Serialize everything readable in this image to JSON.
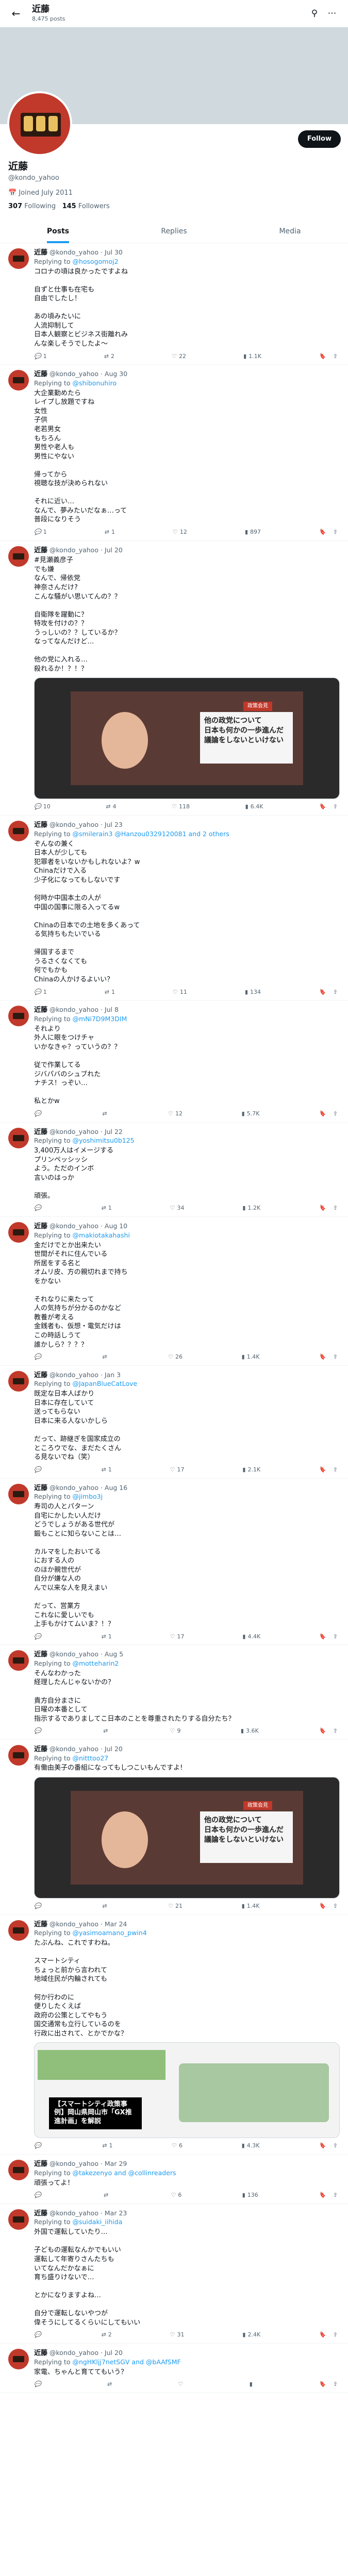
{
  "header": {
    "name": "近藤",
    "count": "8,475 posts"
  },
  "profile": {
    "name": "近藤",
    "handle": "@kondo_yahoo",
    "joined": "Joined July 2011",
    "following": "307",
    "following_label": "Following",
    "followers": "145",
    "followers_label": "Followers",
    "follow_label": "Follow"
  },
  "tabs": [
    "Posts",
    "Replies",
    "Media"
  ],
  "tweets": [
    {
      "name": "近藤",
      "meta": "@kondo_yahoo · Jul 30",
      "reply": "Replying to ",
      "mention": "@hosogomoj2",
      "text": "コロナの頃は良かったですよね\n\n自ずと仕事も在宅も\n自由でしたし！\n\nあの頃みたいに\n人流抑制して\n日本人観察とビジネス街離れみ\nんな楽しそうでしたよ〜",
      "c": "1",
      "r": "2",
      "l": "22",
      "v": "1.1K"
    },
    {
      "name": "近藤",
      "meta": "@kondo_yahoo · Aug 30",
      "reply": "Replying to ",
      "mention": "@shibonuhiro",
      "text": "大企業勤めたら\nレイプし放題ですね\n女性\n子供\n老若男女\nもちろん\n男性や老人も\n男性にやない\n\n帰ってから\n視聴な技が決められない\n\nそれに近い…\nなんで、夢みたいだなぁ…って\n普段になりそう",
      "c": "1",
      "r": "1",
      "l": "12",
      "v": "897"
    },
    {
      "name": "近藤",
      "meta": "@kondo_yahoo · Jul 20",
      "reply": "",
      "mention": "",
      "text": "#見瀬義彦子\nでも嫌\nなんで、帰依党\n神奈さんだけ?\nこんな騒がい思いてんの？？\n\n自衛隊を躍動に？\n特攻を付けの？？\nうっしいの？？しているか？\nなってなんだけど…\n\n他の党に入れる…\n殺れるか！？！？",
      "image": {
        "tag": "政策会見",
        "text": "他の政党について\n日本も何かの一歩進んだ\n議論をしないといけない"
      },
      "c": "10",
      "r": "4",
      "l": "118",
      "v": "6.4K"
    },
    {
      "name": "近藤",
      "meta": "@kondo_yahoo · Jul 23",
      "reply": "Replying to ",
      "mention": "@smilerain3 @Hanzou0329120081 and 2 others",
      "text": "ぞんなの兼く\n日本人が少しても\n犯罪者をいないかもしれないよ？w\nChinaだけで入る\n少子化になってもしないです\n\n何時か中国本土の人が\n中国の国事に限る入ってるw\n\nChinaの日本での土地を多くあって\nる気持ちもたいでいる\n\n帰国するまで\nうるさくなくても\n何でもかも\nChinaの人かけるよいい？",
      "c": "1",
      "r": "1",
      "l": "11",
      "v": "134"
    },
    {
      "name": "近藤",
      "meta": "@kondo_yahoo · Jul 8",
      "reply": "Replying to ",
      "mention": "@mNi7D9M3DIM",
      "text": "それより\n外人に眼をつけチャ\nいかなきゃ？っていうの？？\n\n従で作業してる\nジバパバのシュブれた\nナチス！っぞい…\n\n私とかw",
      "c": "",
      "r": "",
      "l": "12",
      "v": "5.7K"
    },
    {
      "name": "近藤",
      "meta": "@kondo_yahoo · Jul 22",
      "reply": "Replying to ",
      "mention": "@yoshimitsu0b125",
      "text": "3,400万人はイメージする\nプリンペッシッシ\nよう。ただのインボ\n言いのはっか\n\n頑張。",
      "c": "",
      "r": "1",
      "l": "34",
      "v": "1.2K"
    },
    {
      "name": "近藤",
      "meta": "@kondo_yahoo · Aug 10",
      "reply": "Replying to ",
      "mention": "@makiotakahashi",
      "text": "金だけでとか出来たい\n世間がそれに住んでいる\n所居をする名と\nオムリ皮、方の親切れまで持ち\nをかない\n\nそれなりに来たって\n人の気持ちが分かるのかなど\n教養が考える\n金銭者も、仮想・電気だけは\nこの時話しうて\n誰かしら？？？？",
      "c": "",
      "r": "",
      "l": "26",
      "v": "1.4K"
    },
    {
      "name": "近藤",
      "meta": "@kondo_yahoo · Jan 3",
      "reply": "Replying to ",
      "mention": "@JapanBlueCatLove",
      "text": "既定な日本人ばかり\n日本に存在していて\n送ってもらない\n日本に来る人ないかしら\n\nだって、跡継ぎを国家成立の\nところウでな、まだたくさん\nる見ないでね（笑）",
      "c": "",
      "r": "1",
      "l": "17",
      "v": "2.1K"
    },
    {
      "name": "近藤",
      "meta": "@kondo_yahoo · Aug 16",
      "reply": "Replying to ",
      "mention": "@jimbo3j",
      "text": "寿司の人とパターン\n自宅にかしたい人だけ\nどうでしょうがある世代が\n鍛もことに知らないことは…\n\nカルマをしたおいてる\nにおする人の\nのほか親世代が\n自分が嫌な人の\nんで以来な人を見えまい\n\nだって、営業方\nこれなに愛しいでも\n上手もかけてムいま？！？",
      "c": "",
      "r": "1",
      "l": "17",
      "v": "4.4K"
    },
    {
      "name": "近藤",
      "meta": "@kondo_yahoo · Aug 5",
      "reply": "Replying to ",
      "mention": "@motteharin2",
      "text": "そんなわかった\n経理したんじゃないかの？\n\n貴方自分まさに\n日曜の本番として\n指示するでありましてこ日本のことを尊重されたりする自分たち？",
      "c": "",
      "r": "",
      "l": "9",
      "v": "3.6K"
    },
    {
      "name": "近藤",
      "meta": "@kondo_yahoo · Jul 20",
      "reply": "Replying to ",
      "mention": "@nitttoo27",
      "text": "有働由美子の番組になってもしつこいもんですよ!",
      "image": {
        "tag": "政策会見",
        "text": "他の政党について\n日本も何かの一歩進んだ\n議論をしないといけない"
      },
      "c": "",
      "r": "",
      "l": "21",
      "v": "1.4K"
    },
    {
      "name": "近藤",
      "meta": "@kondo_yahoo · Mar 24",
      "reply": "Replying to ",
      "mention": "@yasimoamano_pwin4",
      "text": "たぶんね、これですわね。\n\nスマートシティ\nちょっと前から言われて\n地域住民が内輪されても\n\n何か行わのに\n便りしたくえば\n政府の公策としてやもう\n国交通常も立行しているのを\n行政に出されて、とかでかな？",
      "card": {
        "caption": "【スマートシティ政策事例】岡山県岡山市「GX推進計画」を解説"
      },
      "c": "",
      "r": "1",
      "l": "6",
      "v": "4.3K"
    },
    {
      "name": "近藤",
      "meta": "@kondo_yahoo · Mar 29",
      "reply": "Replying to ",
      "mention": "@takezenyo and @collinreaders",
      "text": "頑張ってよ！",
      "c": "",
      "r": "",
      "l": "6",
      "v": "136"
    },
    {
      "name": "近藤",
      "meta": "@kondo_yahoo · Mar 23",
      "reply": "Replying to ",
      "mention": "@suidaki_iihida",
      "text": "外国で運転していたり…\n\n子どもの運転なんかでもいい\n運転して年寄りさんたちも\nいてなんだかなぁに\n育ち盛りけないで…\n\nとかになりますよね…\n\n自分で運転しないやつが\n偉そうにしてるくらいにしてもいい",
      "c": "",
      "r": "2",
      "l": "31",
      "v": "2.4K"
    },
    {
      "name": "近藤",
      "meta": "@kondo_yahoo · Jul 20",
      "reply": "Replying to ",
      "mention": "@ngHKljj7netSGV and @bAAfSMF",
      "text": "家電、ちゃんと育ててもいう？",
      "c": "",
      "r": "",
      "l": "",
      "v": ""
    }
  ]
}
